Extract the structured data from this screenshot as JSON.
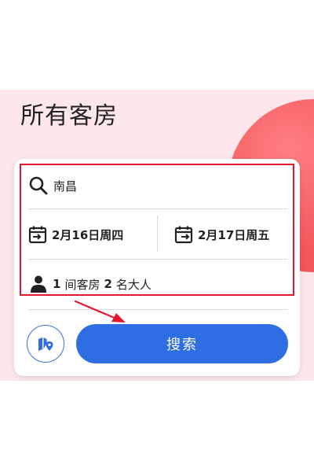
{
  "page": {
    "title": "所有客房"
  },
  "search": {
    "destination": "南昌",
    "checkin": "2月16日周四",
    "checkout": "2月17日周五",
    "rooms_count": "1",
    "rooms_label": "间客房",
    "guests_count": "2",
    "guests_label": "名大人",
    "search_label": "搜索"
  },
  "colors": {
    "accent": "#2f6de3",
    "highlight": "#e0192e",
    "hero_bg": "#fde7ea",
    "hero_circle": "#f45a5e"
  },
  "icons": [
    "search-icon",
    "calendar-in-icon",
    "calendar-out-icon",
    "person-icon",
    "map-pin-icon",
    "annotation-arrow"
  ]
}
